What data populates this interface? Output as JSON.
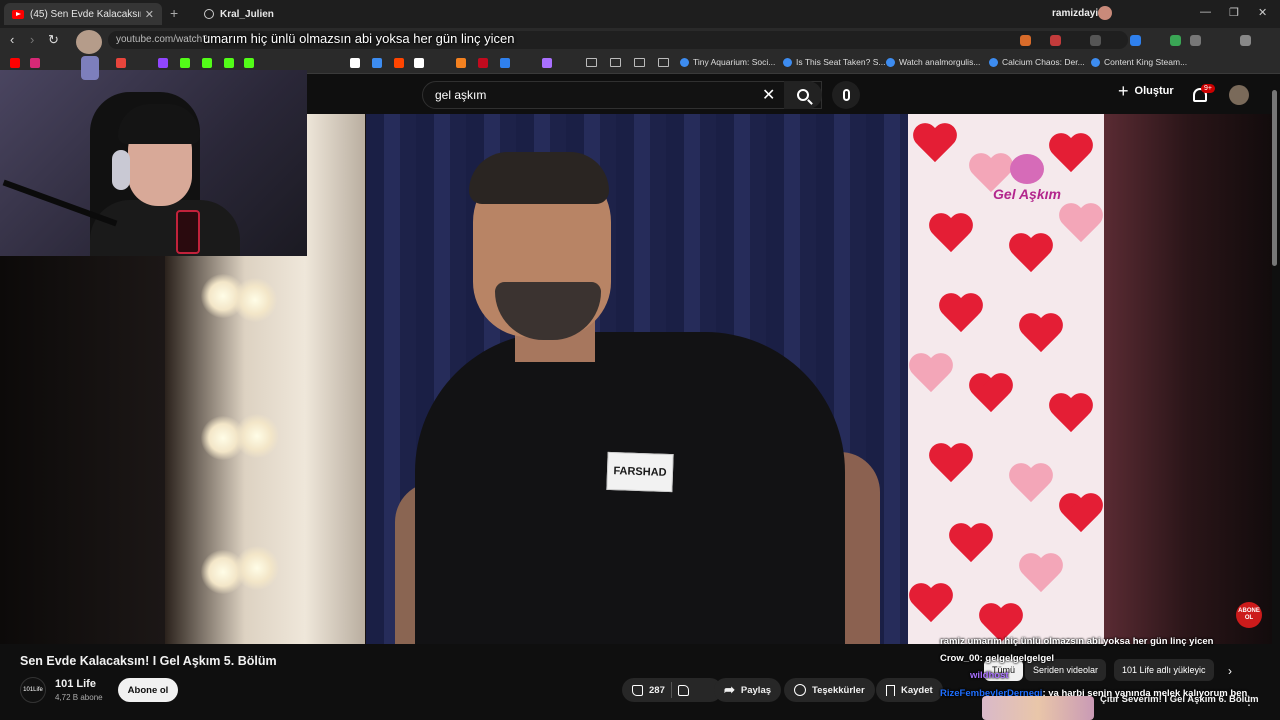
{
  "browser": {
    "active_tab_title": "(45) Sen Evde Kalacaksın! I Ge",
    "other_tab_title": "Kral_Julien",
    "profile_name": "ramizdayi",
    "url": "youtube.com/watch?",
    "bookmarks": [
      "Tiny Aquarium: Soci...",
      "Is This Seat Taken? S...",
      "Watch analmorgulis...",
      "Calcium Chaos: Der...",
      "Content King Steam..."
    ]
  },
  "stream_caption": "umarım hiç ünlü olmazsın abi yoksa her gün linç yicen",
  "youtube": {
    "search_query": "gel aşkım",
    "create_label": "Oluştur",
    "notifications_badge": "9+",
    "video_title": "Sen Evde Kalacaksın! I Gel Aşkım 5. Bölüm",
    "channel_name": "101 Life",
    "channel_logo_text": "101Life",
    "channel_subs": "4,72 B abone",
    "subscribe_label": "Abone ol",
    "likes": "287",
    "share_label": "Paylaş",
    "thanks_label": "Teşekkürler",
    "save_label": "Kaydet",
    "name_tag": "FARSHAD",
    "show_logo": "Gel Aşkım",
    "corner_badge": "ABONE OL",
    "chips": [
      "Tümü",
      "Seriden videolar",
      "101 Life adlı yükleyic"
    ],
    "recommended_title": "Çıtır Severim! I Gel Aşkım 6. Bölüm"
  },
  "chat": [
    {
      "user": "",
      "text": "ramiz umarım hiç ünlü olmazsın abi yoksa her gün linç yicen"
    },
    {
      "user": "Crow_00",
      "text": ": gelgelgelgelgel"
    },
    {
      "user": "wildhost",
      "text": ""
    },
    {
      "user": "RizeFembeylerDernegi",
      "text": ": ya harbi senin yanında melek kalıyorum ben"
    }
  ],
  "colors": {
    "yt_red": "#ff0000",
    "background": "#0f0f0f",
    "pill": "#272727"
  }
}
